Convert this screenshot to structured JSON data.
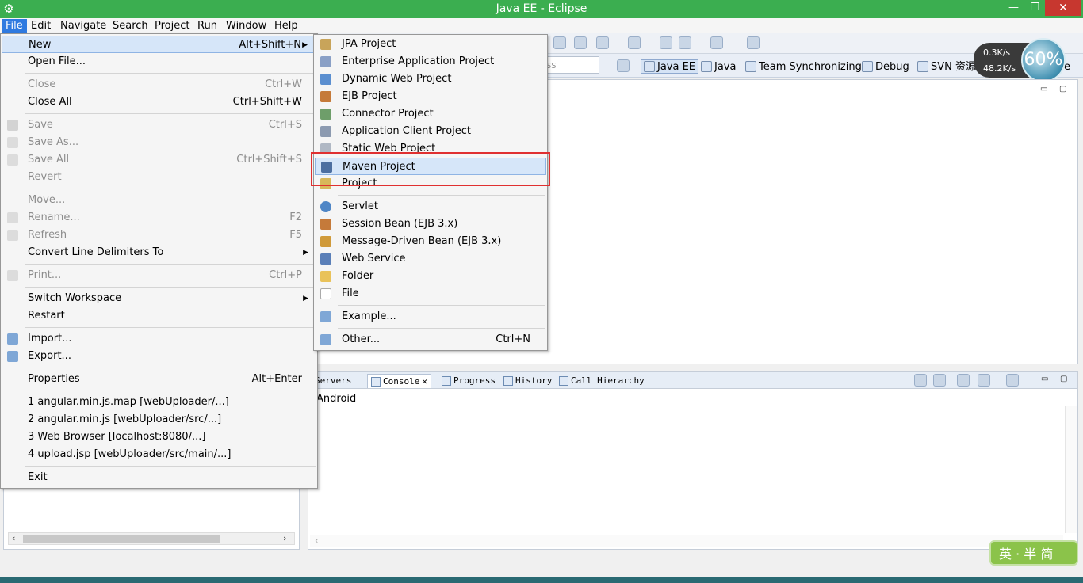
{
  "window": {
    "title": "Java EE - Eclipse",
    "minimize": "—",
    "restore": "❐",
    "close": "✕"
  },
  "menubar": [
    "File",
    "Edit",
    "Navigate",
    "Search",
    "Project",
    "Run",
    "Window",
    "Help"
  ],
  "toolbar": {
    "quick_access_placeholder": "ss"
  },
  "perspectives": [
    {
      "label": "Java EE",
      "active": true
    },
    {
      "label": "Java"
    },
    {
      "label": "Team Synchronizing"
    },
    {
      "label": "Debug"
    },
    {
      "label": "SVN 资源"
    },
    {
      "label": "e"
    }
  ],
  "net_widget": {
    "upload": "0.3K/s",
    "download": "48.2K/s",
    "percent": "60%"
  },
  "file_menu": {
    "new": {
      "label": "New",
      "shortcut": "Alt+Shift+N"
    },
    "open_file": {
      "label": "Open File..."
    },
    "close": {
      "label": "Close",
      "shortcut": "Ctrl+W"
    },
    "close_all": {
      "label": "Close All",
      "shortcut": "Ctrl+Shift+W"
    },
    "save": {
      "label": "Save",
      "shortcut": "Ctrl+S"
    },
    "save_as": {
      "label": "Save As..."
    },
    "save_all": {
      "label": "Save All",
      "shortcut": "Ctrl+Shift+S"
    },
    "revert": {
      "label": "Revert"
    },
    "move": {
      "label": "Move..."
    },
    "rename": {
      "label": "Rename...",
      "shortcut": "F2"
    },
    "refresh": {
      "label": "Refresh",
      "shortcut": "F5"
    },
    "convert": {
      "label": "Convert Line Delimiters To"
    },
    "print": {
      "label": "Print...",
      "shortcut": "Ctrl+P"
    },
    "switch_workspace": {
      "label": "Switch Workspace"
    },
    "restart": {
      "label": "Restart"
    },
    "import": {
      "label": "Import..."
    },
    "export": {
      "label": "Export..."
    },
    "properties": {
      "label": "Properties",
      "shortcut": "Alt+Enter"
    },
    "recent1": {
      "label": "1 angular.min.js.map  [webUploader/...]"
    },
    "recent2": {
      "label": "2 angular.min.js  [webUploader/src/...]"
    },
    "recent3": {
      "label": "3 Web Browser  [localhost:8080/...]"
    },
    "recent4": {
      "label": "4 upload.jsp  [webUploader/src/main/...]"
    },
    "exit": {
      "label": "Exit"
    }
  },
  "new_submenu": {
    "jpa": "JPA Project",
    "enterprise": "Enterprise Application Project",
    "dynamic_web": "Dynamic Web Project",
    "ejb": "EJB Project",
    "connector": "Connector Project",
    "app_client": "Application Client Project",
    "static_web": "Static Web Project",
    "maven": "Maven Project",
    "project": "Project...",
    "servlet": "Servlet",
    "session_bean": "Session Bean (EJB 3.x)",
    "mdb": "Message-Driven Bean (EJB 3.x)",
    "web_service": "Web Service",
    "folder": "Folder",
    "file": "File",
    "example": "Example...",
    "other": {
      "label": "Other...",
      "shortcut": "Ctrl+N"
    }
  },
  "bottom_tabs": [
    "Servers",
    "Console",
    "Progress",
    "History",
    "Call Hierarchy"
  ],
  "console": {
    "text": "Android"
  },
  "ime": {
    "label": "英 · 半 简"
  },
  "colors": {
    "titlebar": "#3bae50",
    "highlight": "#d6e6f9",
    "callout": "#e03030"
  }
}
